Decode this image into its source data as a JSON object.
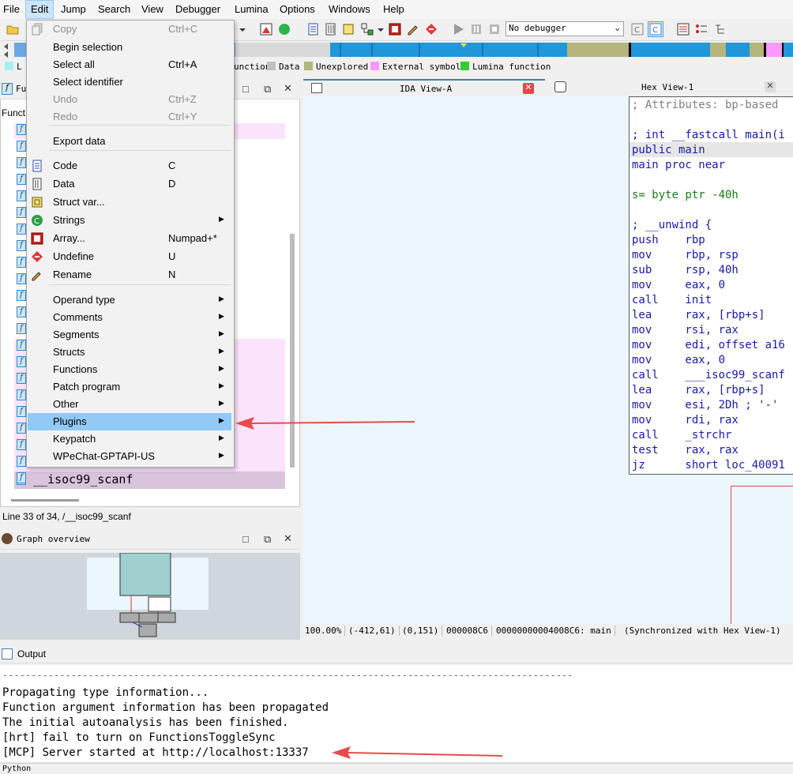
{
  "menubar": {
    "items": [
      "File",
      "Edit",
      "Jump",
      "Search",
      "View",
      "Debugger",
      "Lumina",
      "Options",
      "Windows",
      "Help"
    ]
  },
  "toolbar": {
    "debugger_select": "No debugger"
  },
  "legend": {
    "items": [
      {
        "label": "Lumina function",
        "color": "#33cc33"
      },
      {
        "label": "External symbol",
        "color": "#ff99ff"
      },
      {
        "label": "Unexplored",
        "color": "#b5b57e"
      },
      {
        "label": "Data",
        "color": "#c0c0c0"
      },
      {
        "label": "unction",
        "color": ""
      }
    ],
    "first_label": "L"
  },
  "functions_panel": {
    "title": "Fu",
    "column_label": "Funct",
    "selected_function": "__isoc99_scanf",
    "status": "Line 33 of 34, /__isoc99_scanf"
  },
  "graph_overview": {
    "title": "Graph overview"
  },
  "ida_view": {
    "tab_title": "IDA View-A",
    "hex_tab_title": "Hex View-1",
    "disasm_lines": [
      {
        "text": "; Attributes: bp-based",
        "color": "#808080"
      },
      {
        "text": "",
        "color": "#000"
      },
      {
        "text": "; int __fastcall main(i",
        "color": "#1a1aa6"
      },
      {
        "text": "public main",
        "color": "#1a1aa6"
      },
      {
        "text": "main proc near",
        "color": "#1a1aa6"
      },
      {
        "text": "",
        "color": "#000"
      },
      {
        "text": "s= byte ptr -40h",
        "color": "#1a7a1a"
      },
      {
        "text": "",
        "color": "#000"
      },
      {
        "text": "; __unwind {",
        "color": "#1a1aa6"
      },
      {
        "text": "push    rbp",
        "color": "#1a1aa6"
      },
      {
        "text": "mov     rbp, rsp",
        "color": "#1a1aa6"
      },
      {
        "text": "sub     rsp, 40h",
        "color": "#1a1aa6"
      },
      {
        "text": "mov     eax, 0",
        "color": "#1a1aa6"
      },
      {
        "text": "call    init",
        "color": "#1a1aa6"
      },
      {
        "text": "lea     rax, [rbp+s]",
        "color": "#1a1aa6"
      },
      {
        "text": "mov     rsi, rax",
        "color": "#1a1aa6"
      },
      {
        "text": "mov     edi, offset a16",
        "color": "#1a1aa6"
      },
      {
        "text": "mov     eax, 0",
        "color": "#1a1aa6"
      },
      {
        "text": "call    ___isoc99_scanf",
        "color": "#1a1aa6"
      },
      {
        "text": "lea     rax, [rbp+s]",
        "color": "#1a1aa6"
      },
      {
        "text": "mov     esi, 2Dh ; '-'",
        "color": "#1a1aa6"
      },
      {
        "text": "mov     rdi, rax",
        "color": "#1a1aa6"
      },
      {
        "text": "call    _strchr",
        "color": "#1a1aa6"
      },
      {
        "text": "test    rax, rax",
        "color": "#1a1aa6"
      },
      {
        "text": "jz      short loc_40091",
        "color": "#1a1aa6"
      }
    ],
    "status": {
      "zoom": "100.00%",
      "coords": "(-412,61)",
      "offset": "(0,151)",
      "file_offset": "000008C6",
      "address": "00000000004008C6: main",
      "sync": "(Synchronized with Hex View-1)"
    }
  },
  "context_menu": {
    "items": [
      {
        "label": "Copy",
        "shortcut": "Ctrl+C",
        "disabled": true,
        "submenu": false,
        "icon": "copy-icon"
      },
      {
        "label": "Begin selection",
        "shortcut": "",
        "disabled": false,
        "submenu": false,
        "icon": ""
      },
      {
        "label": "Select all",
        "shortcut": "Ctrl+A",
        "disabled": false,
        "submenu": false,
        "icon": ""
      },
      {
        "label": "Select identifier",
        "shortcut": "",
        "disabled": false,
        "submenu": false,
        "icon": ""
      },
      {
        "label": "Undo",
        "shortcut": "Ctrl+Z",
        "disabled": true,
        "submenu": false,
        "icon": ""
      },
      {
        "label": "Redo",
        "shortcut": "Ctrl+Y",
        "disabled": true,
        "submenu": false,
        "icon": ""
      },
      {
        "label": "Export data",
        "shortcut": "",
        "disabled": false,
        "submenu": false,
        "icon": ""
      },
      {
        "label": "Code",
        "shortcut": "C",
        "disabled": false,
        "submenu": false,
        "icon": "code-icon"
      },
      {
        "label": "Data",
        "shortcut": "D",
        "disabled": false,
        "submenu": false,
        "icon": "data-icon"
      },
      {
        "label": "Struct var...",
        "shortcut": "",
        "disabled": false,
        "submenu": false,
        "icon": "struct-icon"
      },
      {
        "label": "Strings",
        "shortcut": "",
        "disabled": false,
        "submenu": true,
        "icon": "strings-icon"
      },
      {
        "label": "Array...",
        "shortcut": "Numpad+*",
        "disabled": false,
        "submenu": false,
        "icon": "array-icon"
      },
      {
        "label": "Undefine",
        "shortcut": "U",
        "disabled": false,
        "submenu": false,
        "icon": "undefine-icon"
      },
      {
        "label": "Rename",
        "shortcut": "N",
        "disabled": false,
        "submenu": false,
        "icon": "rename-icon"
      },
      {
        "label": "Operand type",
        "shortcut": "",
        "disabled": false,
        "submenu": true,
        "icon": ""
      },
      {
        "label": "Comments",
        "shortcut": "",
        "disabled": false,
        "submenu": true,
        "icon": ""
      },
      {
        "label": "Segments",
        "shortcut": "",
        "disabled": false,
        "submenu": true,
        "icon": ""
      },
      {
        "label": "Structs",
        "shortcut": "",
        "disabled": false,
        "submenu": true,
        "icon": ""
      },
      {
        "label": "Functions",
        "shortcut": "",
        "disabled": false,
        "submenu": true,
        "icon": ""
      },
      {
        "label": "Patch program",
        "shortcut": "",
        "disabled": false,
        "submenu": true,
        "icon": ""
      },
      {
        "label": "Other",
        "shortcut": "",
        "disabled": false,
        "submenu": true,
        "icon": ""
      },
      {
        "label": "Plugins",
        "shortcut": "",
        "disabled": false,
        "submenu": true,
        "icon": "",
        "highlighted": true
      },
      {
        "label": "Keypatch",
        "shortcut": "",
        "disabled": false,
        "submenu": true,
        "icon": ""
      },
      {
        "label": "WPeChat-GPTAPI-US",
        "shortcut": "",
        "disabled": false,
        "submenu": true,
        "icon": ""
      }
    ]
  },
  "output": {
    "title": "Output",
    "lines": [
      "----------------------------------------------------------------------------------------------------",
      "Propagating type information...",
      "Function argument information has been propagated",
      "The initial autoanalysis has been finished.",
      "[hrt] fail to turn on FunctionsToggleSync",
      "[MCP] Server started at http://localhost:13337"
    ],
    "python_tab": "Python"
  },
  "colors": {
    "accent_arrow": "#e84a4a",
    "menu_highlight": "#91c9f7",
    "ida_background": "#ecf7fd"
  }
}
